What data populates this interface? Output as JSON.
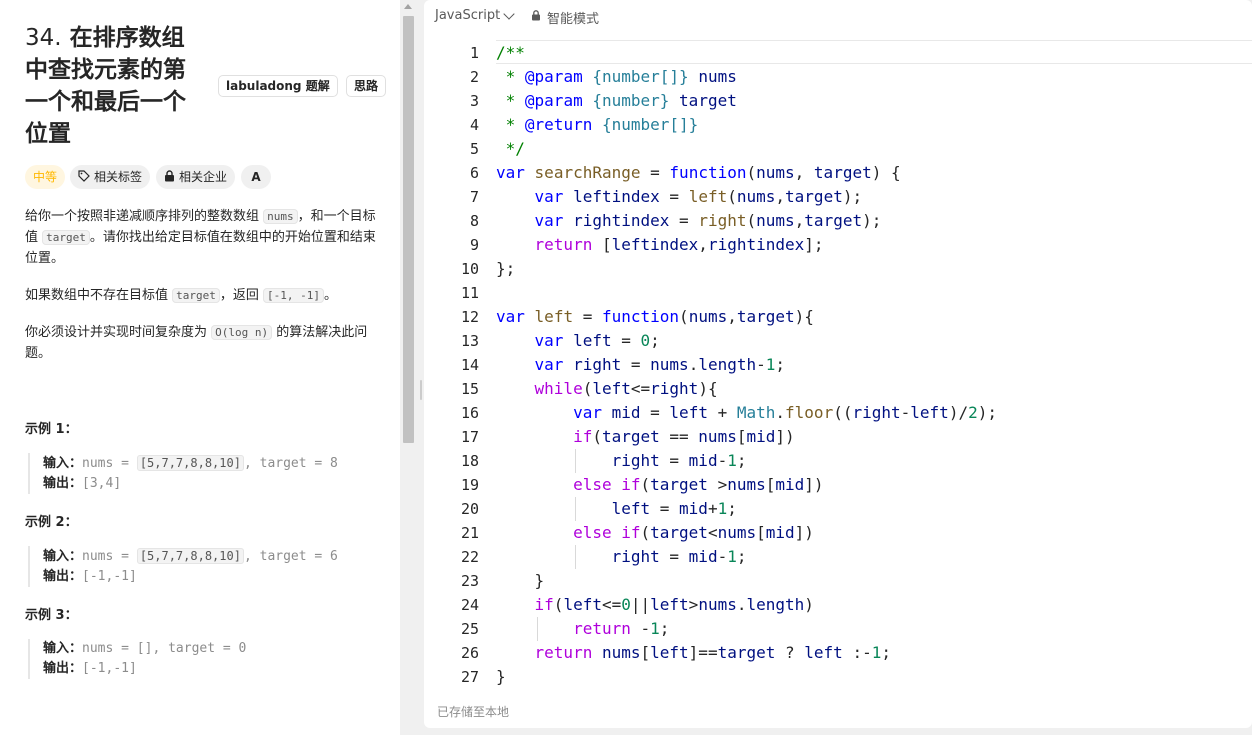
{
  "problem": {
    "number": "34.",
    "title": "在排序数组中查找元素的第一个和最后一个位置",
    "title_lines": [
      "在排序数组",
      "中查找元素的第",
      "一个和最后一个",
      "位置"
    ],
    "btn_labuladong": "labuladong 题解",
    "btn_silu": "思路",
    "tags": {
      "difficulty": "中等",
      "topics": "相关标签",
      "company": "相关企业",
      "translate": "A"
    },
    "desc1": [
      "给你一个按照非递减顺序排列的整数数组 ",
      "nums",
      "，和一个目标值 ",
      "target",
      "。请你找出给定目标值在数组中的开始位置和结束位置。"
    ],
    "desc2": [
      "如果数组中不存在目标值 ",
      "target",
      "，返回 ",
      "[-1, -1]",
      "。"
    ],
    "desc3": [
      "你必须设计并实现时间复杂度为 ",
      "O(log n)",
      " 的算法解决此问题。"
    ],
    "examples": [
      {
        "title": "示例 1：",
        "in_label": "输入：",
        "in_pre": "nums = ",
        "in_arr": "[5,7,7,8,8,10]",
        "in_post": ", target = 8",
        "out_label": "输出：",
        "out": "[3,4]"
      },
      {
        "title": "示例 2：",
        "in_label": "输入：",
        "in_pre": "nums = ",
        "in_arr": "[5,7,7,8,8,10]",
        "in_post": ", target = 6",
        "out_label": "输出：",
        "out": "[-1,-1]"
      },
      {
        "title": "示例 3：",
        "in_label": "输入：",
        "in_pre": "nums = [], target = 0",
        "in_arr": "",
        "in_post": "",
        "out_label": "输出：",
        "out": "[-1,-1]"
      }
    ]
  },
  "editor": {
    "language": "JavaScript",
    "mode": "智能模式",
    "footer": "已存储至本地",
    "lines": [
      [
        [
          "c-com",
          "/**"
        ]
      ],
      [
        [
          "c-com",
          " * "
        ],
        [
          "c-tag",
          "@param"
        ],
        [
          "c-com",
          " "
        ],
        [
          "c-type",
          "{number[]}"
        ],
        [
          "c-com",
          " "
        ],
        [
          "c-var",
          "nums"
        ]
      ],
      [
        [
          "c-com",
          " * "
        ],
        [
          "c-tag",
          "@param"
        ],
        [
          "c-com",
          " "
        ],
        [
          "c-type",
          "{number}"
        ],
        [
          "c-com",
          " "
        ],
        [
          "c-var",
          "target"
        ]
      ],
      [
        [
          "c-com",
          " * "
        ],
        [
          "c-tag",
          "@return"
        ],
        [
          "c-com",
          " "
        ],
        [
          "c-type",
          "{number[]}"
        ]
      ],
      [
        [
          "c-com",
          " */"
        ]
      ],
      [
        [
          "c-kw",
          "var"
        ],
        [
          "c-pl",
          " "
        ],
        [
          "c-fn",
          "searchRange"
        ],
        [
          "c-pl",
          " = "
        ],
        [
          "c-kw",
          "function"
        ],
        [
          "c-pl",
          "("
        ],
        [
          "c-var",
          "nums"
        ],
        [
          "c-pl",
          ", "
        ],
        [
          "c-var",
          "target"
        ],
        [
          "c-pl",
          ") {"
        ]
      ],
      [
        [
          "c-pl",
          "    "
        ],
        [
          "c-kw",
          "var"
        ],
        [
          "c-pl",
          " "
        ],
        [
          "c-var",
          "leftindex"
        ],
        [
          "c-pl",
          " = "
        ],
        [
          "c-fn",
          "left"
        ],
        [
          "c-pl",
          "("
        ],
        [
          "c-var",
          "nums"
        ],
        [
          "c-pl",
          ","
        ],
        [
          "c-var",
          "target"
        ],
        [
          "c-pl",
          ");"
        ]
      ],
      [
        [
          "c-pl",
          "    "
        ],
        [
          "c-kw",
          "var"
        ],
        [
          "c-pl",
          " "
        ],
        [
          "c-var",
          "rightindex"
        ],
        [
          "c-pl",
          " = "
        ],
        [
          "c-fn",
          "right"
        ],
        [
          "c-pl",
          "("
        ],
        [
          "c-var",
          "nums"
        ],
        [
          "c-pl",
          ","
        ],
        [
          "c-var",
          "target"
        ],
        [
          "c-pl",
          ");"
        ]
      ],
      [
        [
          "c-pl",
          "    "
        ],
        [
          "c-ctl",
          "return"
        ],
        [
          "c-pl",
          " ["
        ],
        [
          "c-var",
          "leftindex"
        ],
        [
          "c-pl",
          ","
        ],
        [
          "c-var",
          "rightindex"
        ],
        [
          "c-pl",
          "];"
        ]
      ],
      [
        [
          "c-pl",
          "};"
        ]
      ],
      [
        [
          "c-pl",
          ""
        ]
      ],
      [
        [
          "c-kw",
          "var"
        ],
        [
          "c-pl",
          " "
        ],
        [
          "c-fn",
          "left"
        ],
        [
          "c-pl",
          " = "
        ],
        [
          "c-kw",
          "function"
        ],
        [
          "c-pl",
          "("
        ],
        [
          "c-var",
          "nums"
        ],
        [
          "c-pl",
          ","
        ],
        [
          "c-var",
          "target"
        ],
        [
          "c-pl",
          "){"
        ]
      ],
      [
        [
          "c-pl",
          "    "
        ],
        [
          "c-kw",
          "var"
        ],
        [
          "c-pl",
          " "
        ],
        [
          "c-var",
          "left"
        ],
        [
          "c-pl",
          " = "
        ],
        [
          "c-num",
          "0"
        ],
        [
          "c-pl",
          ";"
        ]
      ],
      [
        [
          "c-pl",
          "    "
        ],
        [
          "c-kw",
          "var"
        ],
        [
          "c-pl",
          " "
        ],
        [
          "c-var",
          "right"
        ],
        [
          "c-pl",
          " = "
        ],
        [
          "c-var",
          "nums"
        ],
        [
          "c-pl",
          "."
        ],
        [
          "c-var",
          "length"
        ],
        [
          "c-pl",
          "-"
        ],
        [
          "c-num",
          "1"
        ],
        [
          "c-pl",
          ";"
        ]
      ],
      [
        [
          "c-pl",
          "    "
        ],
        [
          "c-ctl",
          "while"
        ],
        [
          "c-pl",
          "("
        ],
        [
          "c-var",
          "left"
        ],
        [
          "c-pl",
          "<="
        ],
        [
          "c-var",
          "right"
        ],
        [
          "c-pl",
          "){"
        ]
      ],
      [
        [
          "c-pl",
          "        "
        ],
        [
          "c-kw",
          "var"
        ],
        [
          "c-pl",
          " "
        ],
        [
          "c-var",
          "mid"
        ],
        [
          "c-pl",
          " = "
        ],
        [
          "c-var",
          "left"
        ],
        [
          "c-pl",
          " + "
        ],
        [
          "c-cls",
          "Math"
        ],
        [
          "c-pl",
          "."
        ],
        [
          "c-fn",
          "floor"
        ],
        [
          "c-pl",
          "(("
        ],
        [
          "c-var",
          "right"
        ],
        [
          "c-pl",
          "-"
        ],
        [
          "c-var",
          "left"
        ],
        [
          "c-pl",
          ")/"
        ],
        [
          "c-num",
          "2"
        ],
        [
          "c-pl",
          ");"
        ]
      ],
      [
        [
          "c-pl",
          "        "
        ],
        [
          "c-ctl",
          "if"
        ],
        [
          "c-pl",
          "("
        ],
        [
          "c-var",
          "target"
        ],
        [
          "c-pl",
          " == "
        ],
        [
          "c-var",
          "nums"
        ],
        [
          "c-pl",
          "["
        ],
        [
          "c-var",
          "mid"
        ],
        [
          "c-pl",
          "])"
        ]
      ],
      [
        [
          "c-pl",
          "            "
        ],
        [
          "c-var",
          "right"
        ],
        [
          "c-pl",
          " = "
        ],
        [
          "c-var",
          "mid"
        ],
        [
          "c-pl",
          "-"
        ],
        [
          "c-num",
          "1"
        ],
        [
          "c-pl",
          ";"
        ]
      ],
      [
        [
          "c-pl",
          "        "
        ],
        [
          "c-ctl",
          "else"
        ],
        [
          "c-pl",
          " "
        ],
        [
          "c-ctl",
          "if"
        ],
        [
          "c-pl",
          "("
        ],
        [
          "c-var",
          "target"
        ],
        [
          "c-pl",
          " >"
        ],
        [
          "c-var",
          "nums"
        ],
        [
          "c-pl",
          "["
        ],
        [
          "c-var",
          "mid"
        ],
        [
          "c-pl",
          "])"
        ]
      ],
      [
        [
          "c-pl",
          "            "
        ],
        [
          "c-var",
          "left"
        ],
        [
          "c-pl",
          " = "
        ],
        [
          "c-var",
          "mid"
        ],
        [
          "c-pl",
          "+"
        ],
        [
          "c-num",
          "1"
        ],
        [
          "c-pl",
          ";"
        ]
      ],
      [
        [
          "c-pl",
          "        "
        ],
        [
          "c-ctl",
          "else"
        ],
        [
          "c-pl",
          " "
        ],
        [
          "c-ctl",
          "if"
        ],
        [
          "c-pl",
          "("
        ],
        [
          "c-var",
          "target"
        ],
        [
          "c-pl",
          "<"
        ],
        [
          "c-var",
          "nums"
        ],
        [
          "c-pl",
          "["
        ],
        [
          "c-var",
          "mid"
        ],
        [
          "c-pl",
          "])"
        ]
      ],
      [
        [
          "c-pl",
          "            "
        ],
        [
          "c-var",
          "right"
        ],
        [
          "c-pl",
          " = "
        ],
        [
          "c-var",
          "mid"
        ],
        [
          "c-pl",
          "-"
        ],
        [
          "c-num",
          "1"
        ],
        [
          "c-pl",
          ";"
        ]
      ],
      [
        [
          "c-pl",
          "    }"
        ]
      ],
      [
        [
          "c-pl",
          "    "
        ],
        [
          "c-ctl",
          "if"
        ],
        [
          "c-pl",
          "("
        ],
        [
          "c-var",
          "left"
        ],
        [
          "c-pl",
          "<="
        ],
        [
          "c-num",
          "0"
        ],
        [
          "c-pl",
          "||"
        ],
        [
          "c-var",
          "left"
        ],
        [
          "c-pl",
          ">"
        ],
        [
          "c-var",
          "nums"
        ],
        [
          "c-pl",
          "."
        ],
        [
          "c-var",
          "length"
        ],
        [
          "c-pl",
          ")"
        ]
      ],
      [
        [
          "c-pl",
          "        "
        ],
        [
          "c-ctl",
          "return"
        ],
        [
          "c-pl",
          " -"
        ],
        [
          "c-num",
          "1"
        ],
        [
          "c-pl",
          ";"
        ]
      ],
      [
        [
          "c-pl",
          "    "
        ],
        [
          "c-ctl",
          "return"
        ],
        [
          "c-pl",
          " "
        ],
        [
          "c-var",
          "nums"
        ],
        [
          "c-pl",
          "["
        ],
        [
          "c-var",
          "left"
        ],
        [
          "c-pl",
          "]=="
        ],
        [
          "c-var",
          "target"
        ],
        [
          "c-pl",
          " ? "
        ],
        [
          "c-var",
          "left"
        ],
        [
          "c-pl",
          " :-"
        ],
        [
          "c-num",
          "1"
        ],
        [
          "c-pl",
          ";"
        ]
      ],
      [
        [
          "c-pl",
          "}"
        ]
      ]
    ]
  }
}
